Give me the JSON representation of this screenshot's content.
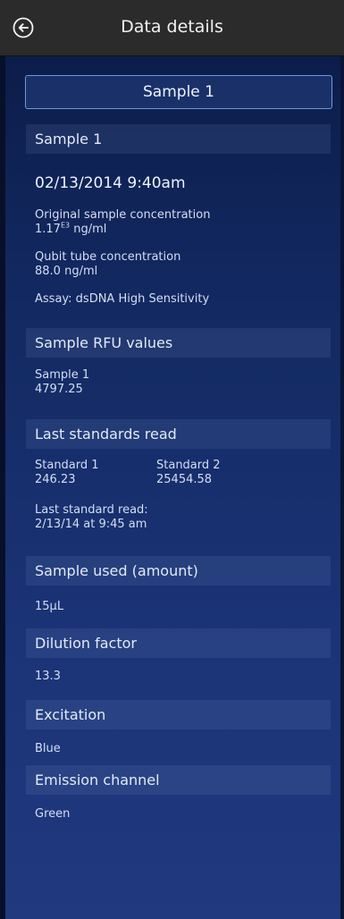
{
  "header": {
    "title": "Data details",
    "back_icon": "back-arrow-circle-icon"
  },
  "sample_button": {
    "label": "Sample 1"
  },
  "sections": {
    "sample": {
      "title": "Sample 1",
      "datetime": "02/13/2014 9:40am",
      "original_label": "Original sample concentration",
      "original_value_mantissa": "1.17",
      "original_value_exponent": "E3",
      "original_value_unit": "ng/ml",
      "qubit_label": "Qubit tube concentration",
      "qubit_value": "88.0 ng/ml",
      "assay": "Assay: dsDNA High Sensitivity"
    },
    "rfu": {
      "title": "Sample RFU values",
      "label": "Sample 1",
      "value": "4797.25"
    },
    "standards": {
      "title": "Last standards read",
      "s1_label": "Standard 1",
      "s1_value": "246.23",
      "s2_label": "Standard 2",
      "s2_value": "25454.58",
      "last_label": "Last standard read:",
      "last_value": "2/13/14 at 9:45 am"
    },
    "sample_used": {
      "title": "Sample used (amount)",
      "value": "15µL"
    },
    "dilution": {
      "title": "Dilution factor",
      "value": "13.3"
    },
    "excitation": {
      "title": "Excitation",
      "value": "Blue"
    },
    "emission": {
      "title": "Emission channel",
      "value": "Green"
    }
  }
}
